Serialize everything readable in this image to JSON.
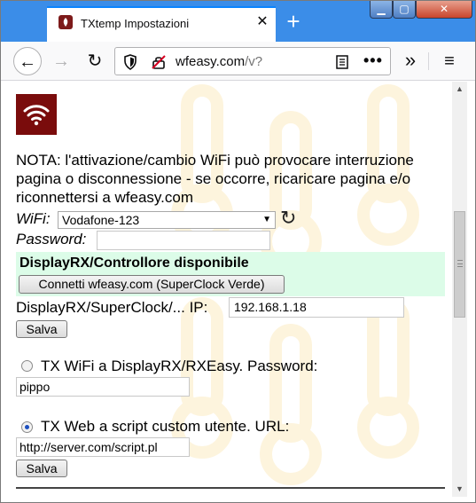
{
  "window": {
    "tab_title": "TXtemp Impostazioni",
    "tab_close": "✕",
    "new_tab": "+",
    "min": "▁",
    "max": "▢",
    "close": "✕"
  },
  "toolbar": {
    "back": "←",
    "forward": "→",
    "reload": "↻",
    "url_host": "wfeasy.com",
    "url_path": "/v?",
    "page_actions": "•••",
    "overflow": "»",
    "menu": "≡"
  },
  "page": {
    "nota": "NOTA: l'attivazione/cambio WiFi può provocare interruzione pagina o disconnessione - se occorre, ricaricare pagina e/o riconnettersi a wfeasy.com",
    "wifi_label": "WiFi:",
    "wifi_selected": "Vodafone-123",
    "password_label": "Password:",
    "password_value": "",
    "panel_title": "DisplayRX/Controllore disponibile",
    "panel_button": "Connetti wfeasy.com (SuperClock Verde)",
    "ip_label": "DisplayRX/SuperClock/... IP:",
    "ip_value": "192.168.1.18",
    "save_label": "Salva",
    "option1_label": "TX WiFi a DisplayRX/RXEasy. Password:",
    "option1_value": "pippo",
    "option1_selected": false,
    "option2_label": "TX Web a script custom utente. URL:",
    "option2_value": "http://server.com/script.pl",
    "option2_selected": true,
    "save2_label": "Salva"
  },
  "icons": {
    "favicon": "wifi-icon",
    "logo": "wifi-icon",
    "refresh": "refresh-icon",
    "shield": "shield-icon",
    "tracking": "tracking-blocked-icon",
    "reader": "reader-view-icon"
  },
  "colors": {
    "brand": "#7a0c0c",
    "panel_bg": "#dcfce8",
    "tabstrip": "#3b8de8"
  }
}
